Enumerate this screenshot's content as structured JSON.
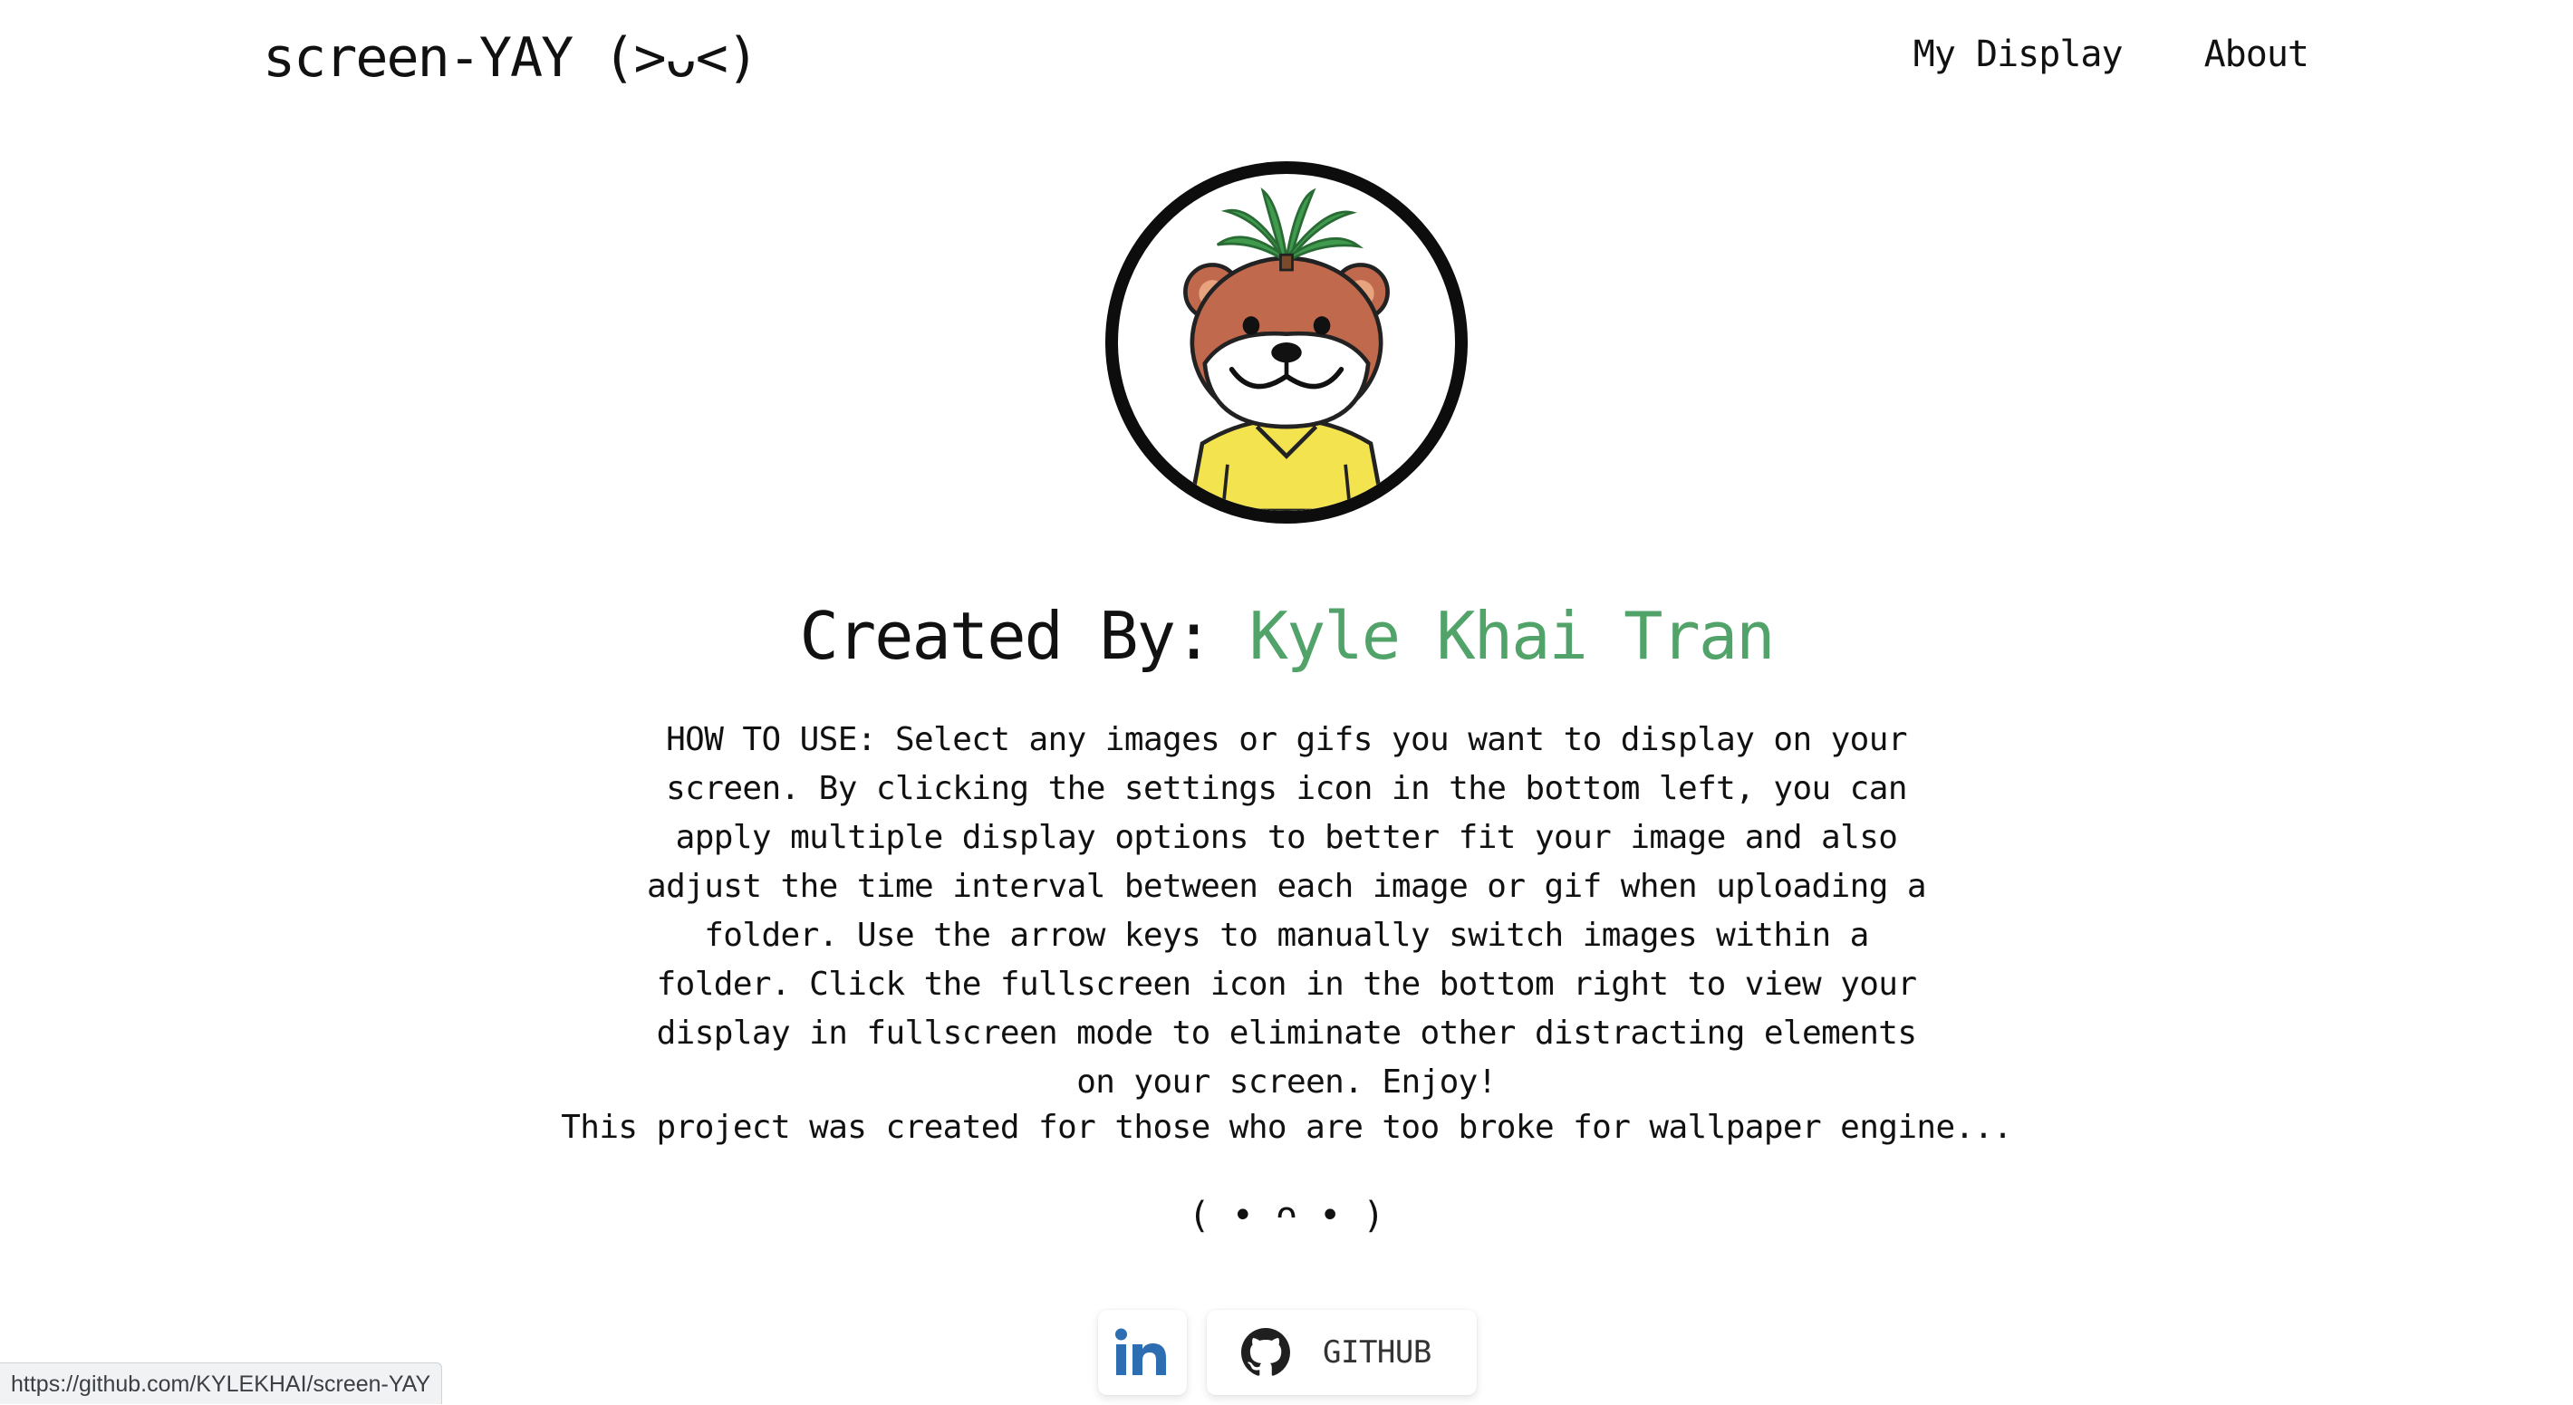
{
  "header": {
    "brand": "screen-YAY (>ᴗ<)",
    "nav": [
      {
        "label": "My Display"
      },
      {
        "label": "About"
      }
    ]
  },
  "about": {
    "created_prefix": "Created By:",
    "creator_name": "Kyle Khai Tran",
    "creator_color": "#52a36a",
    "how_to": "HOW TO USE: Select any images or gifs you want to display on your screen. By clicking the settings icon in the bottom left, you can apply multiple display options to better fit your image and also adjust the time interval between each image or gif when uploading a folder. Use the arrow keys to manually switch images within a folder. Click the fullscreen icon in the bottom right to view your display in fullscreen mode to eliminate other distracting elements on your screen. Enjoy!",
    "tagline": "This project was created for those who are too broke for wallpaper engine...",
    "kaomoji": "( • ᴖ • )"
  },
  "social": {
    "linkedin_icon": "linkedin-icon",
    "linkedin_color": "#2d6db2",
    "github_icon": "github-icon",
    "github_label": "GITHUB"
  },
  "status_bar": {
    "url": "https://github.com/KYLEKHAI/screen-YAY"
  }
}
